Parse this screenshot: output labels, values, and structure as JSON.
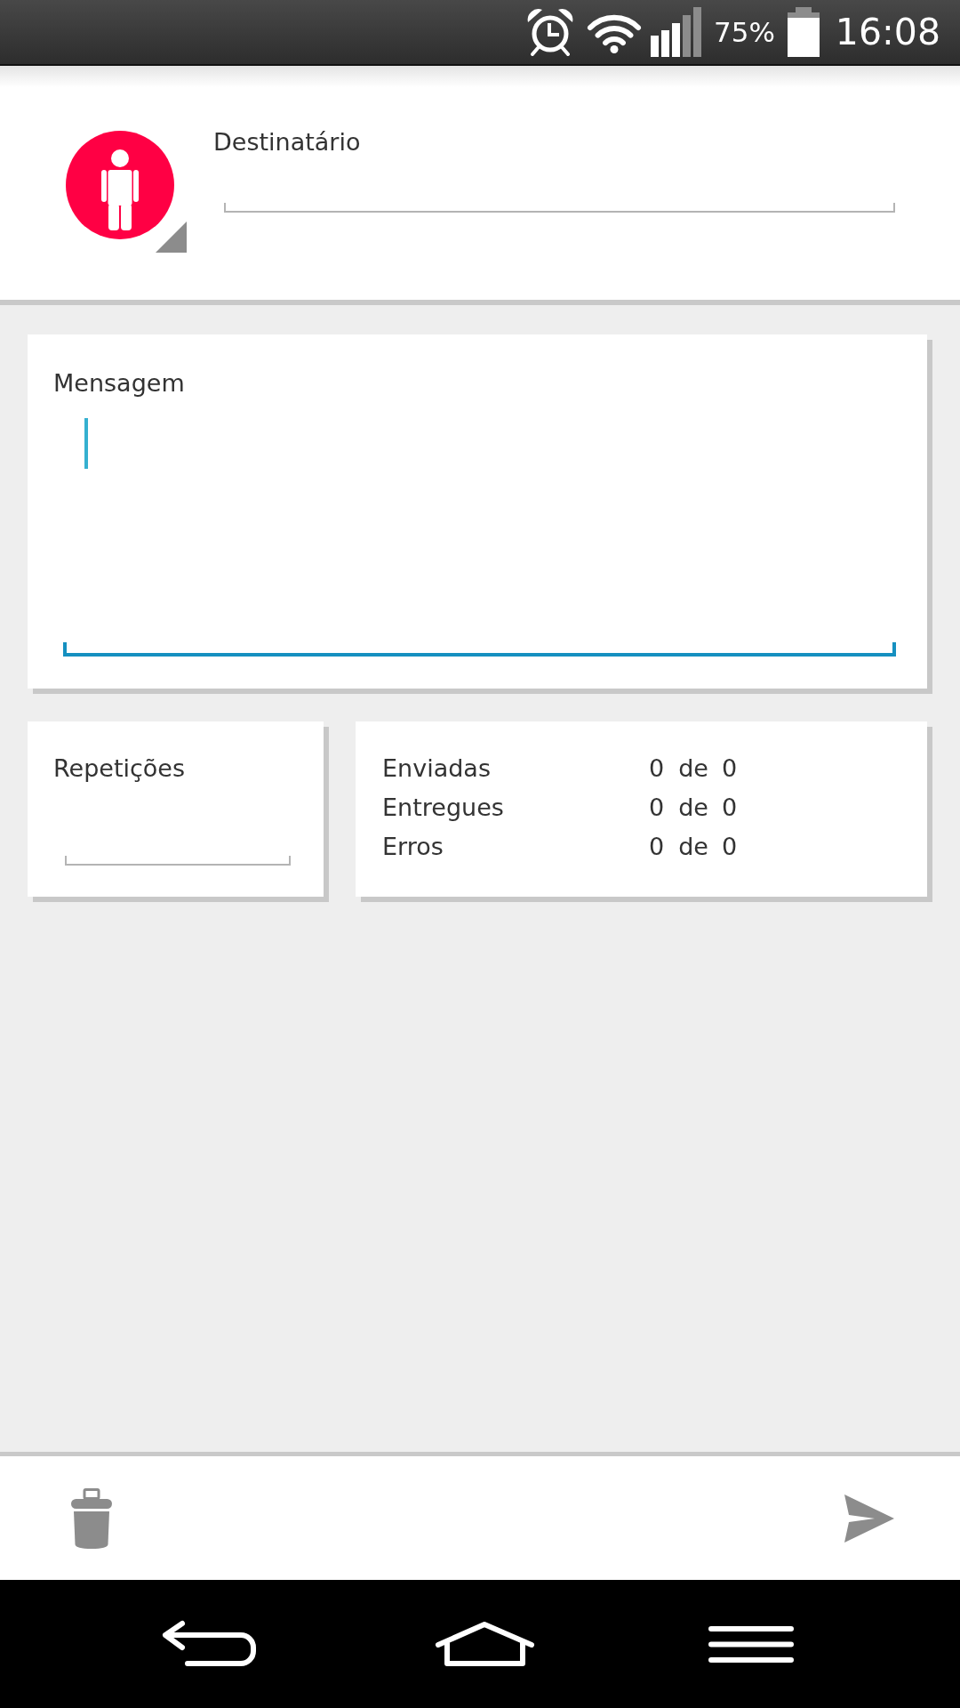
{
  "status_bar": {
    "battery": "75%",
    "time": "16:08"
  },
  "recipient": {
    "label": "Destinatário",
    "focused": false
  },
  "message": {
    "label": "Mensagem",
    "focused": true
  },
  "repetitions": {
    "label": "Repetições",
    "focused": false
  },
  "stats": [
    {
      "label": "Enviadas",
      "count": "0",
      "separator": "de",
      "total": "0"
    },
    {
      "label": "Entregues",
      "count": "0",
      "separator": "de",
      "total": "0"
    },
    {
      "label": "Erros",
      "count": "0",
      "separator": "de",
      "total": "0"
    }
  ]
}
